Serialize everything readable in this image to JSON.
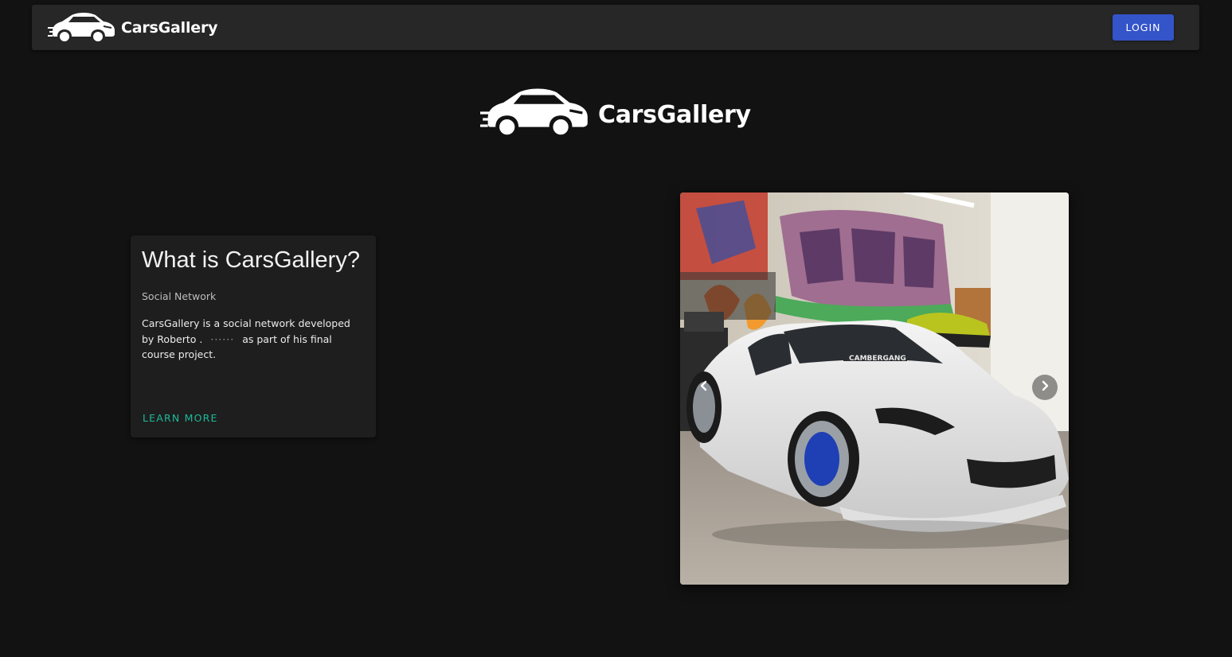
{
  "navbar": {
    "brand_name": "CarsGallery",
    "logo_icon": "car-logo-icon",
    "login_label": "LOGIN"
  },
  "hero": {
    "brand_name": "CarsGallery",
    "logo_icon": "car-logo-icon"
  },
  "card": {
    "title": "What is CarsGallery?",
    "subtitle": "Social Network",
    "text_before": "CarsGallery is a social network developed by Roberto .",
    "redacted": "······",
    "text_after": "as part of his final course project.",
    "link_label": "LEARN MORE"
  },
  "carousel": {
    "windshield_banner": "CAMBERGANG",
    "prev_icon": "chevron-left-icon",
    "next_icon": "chevron-right-icon"
  },
  "colors": {
    "background": "#121212",
    "navbar": "#272727",
    "card": "#1e1e1e",
    "primary_button": "#3454c9",
    "link_accent": "#1fb89a"
  }
}
